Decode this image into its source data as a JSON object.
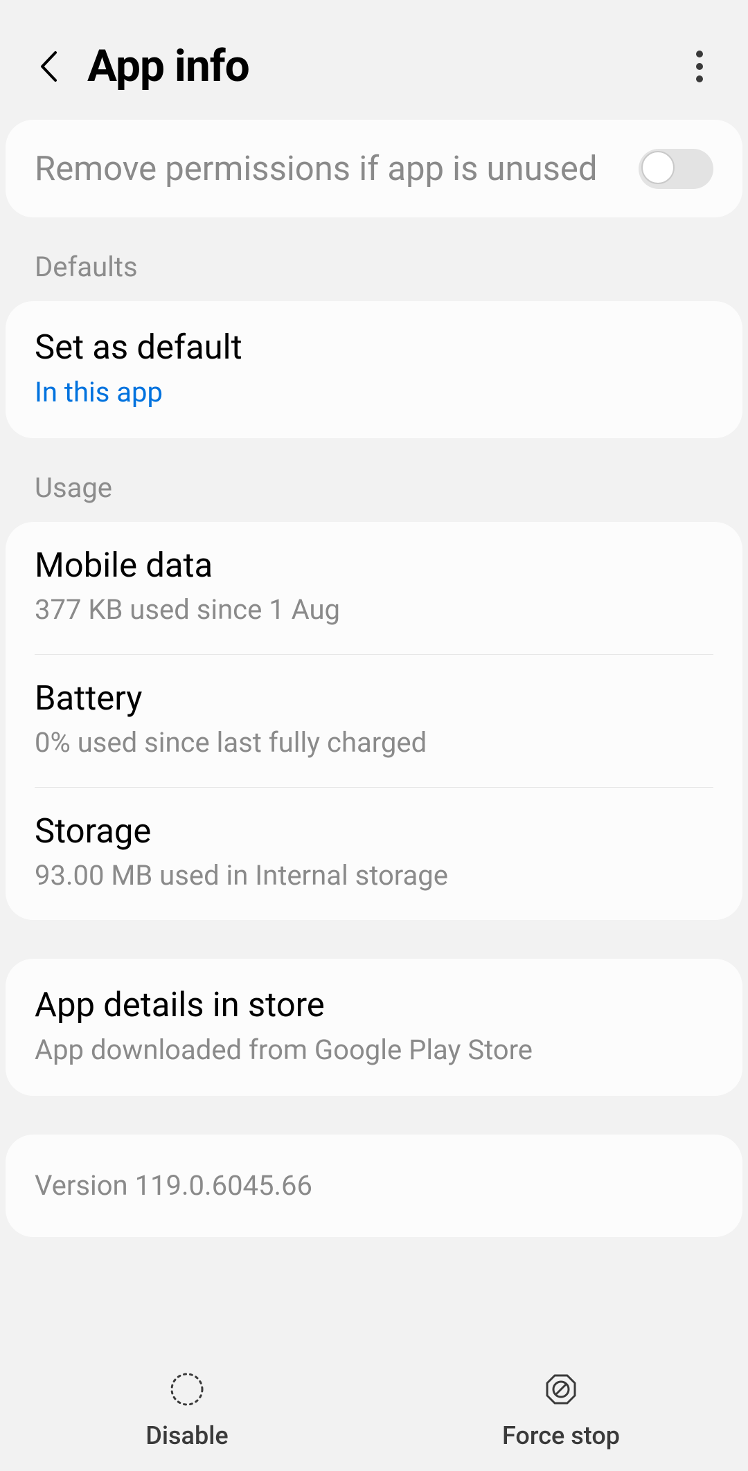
{
  "header": {
    "title": "App info"
  },
  "remove_permissions": {
    "label": "Remove permissions if app is unused",
    "enabled": false
  },
  "sections": {
    "defaults_label": "Defaults",
    "usage_label": "Usage"
  },
  "defaults": {
    "set_default_title": "Set as default",
    "set_default_sub": "In this app"
  },
  "usage": {
    "mobile_data_title": "Mobile data",
    "mobile_data_sub": "377 KB used since 1 Aug",
    "battery_title": "Battery",
    "battery_sub": "0% used since last fully charged",
    "storage_title": "Storage",
    "storage_sub": "93.00 MB used in Internal storage"
  },
  "store": {
    "title": "App details in store",
    "sub": "App downloaded from Google Play Store"
  },
  "version": {
    "text": "Version 119.0.6045.66"
  },
  "bottom": {
    "disable": "Disable",
    "force_stop": "Force stop"
  }
}
